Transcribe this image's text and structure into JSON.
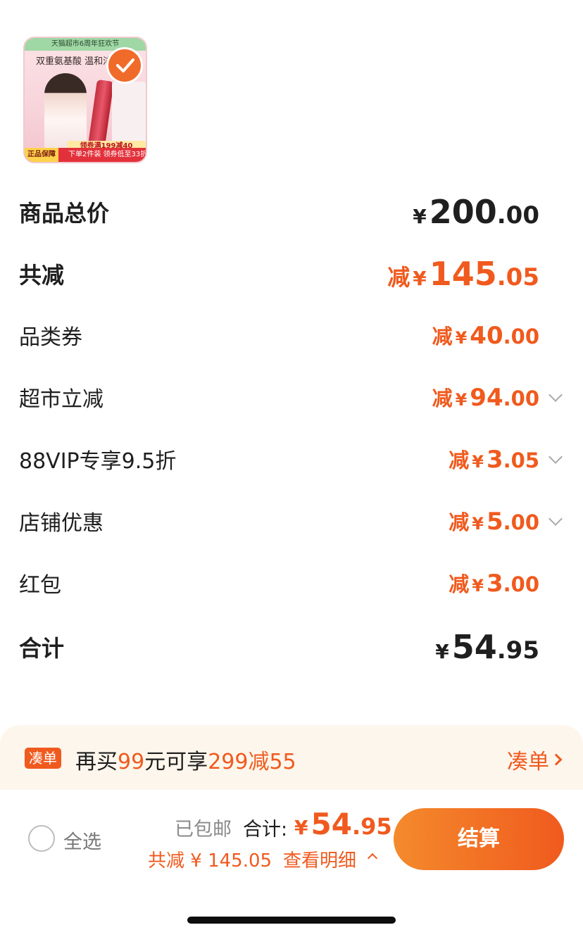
{
  "product": {
    "top_banner": "天猫超市6周年狂欢节",
    "headline": "双重氨基酸 温和洁净",
    "coupon_strip": "领券满199减40",
    "bottom_text": "下单2件装 领券低至33折",
    "badge": "正品保障",
    "selected": true
  },
  "summary": {
    "goods_total": {
      "label": "商品总价",
      "currency": "¥",
      "int": "200",
      "dec": ".00"
    },
    "total_reduction": {
      "label": "共减",
      "prefix": "减",
      "currency": "¥",
      "int": "145",
      "dec": ".05"
    },
    "items": [
      {
        "label": "品类券",
        "prefix": "减",
        "currency": "¥",
        "int": "40",
        "dec": ".00",
        "expandable": false
      },
      {
        "label": "超市立减",
        "prefix": "减",
        "currency": "¥",
        "int": "94",
        "dec": ".00",
        "expandable": true
      },
      {
        "label": "88VIP专享9.5折",
        "prefix": "减",
        "currency": "¥",
        "int": "3",
        "dec": ".05",
        "expandable": true
      },
      {
        "label": "店铺优惠",
        "prefix": "减",
        "currency": "¥",
        "int": "5",
        "dec": ".00",
        "expandable": true
      },
      {
        "label": "红包",
        "prefix": "减",
        "currency": "¥",
        "int": "3",
        "dec": ".00",
        "expandable": false
      }
    ],
    "grand_total": {
      "label": "合计",
      "currency": "¥",
      "int": "54",
      "dec": ".95"
    }
  },
  "promo": {
    "tag": "凑单",
    "text_a": "再买",
    "text_b": "99",
    "text_c": "元可享",
    "text_d": "299减55",
    "link": "凑单"
  },
  "bottombar": {
    "select_all": "全选",
    "shipping": "已包邮",
    "total_label": "合计:",
    "total_currency": "¥",
    "total_int": "54",
    "total_dec": ".95",
    "saved": "共减 ¥ 145.05",
    "detail": "查看明细",
    "checkout": "结算"
  },
  "colors": {
    "accent": "#f05a1e",
    "promo_bg": "#fdf6ec",
    "text": "#1f1f1f"
  }
}
